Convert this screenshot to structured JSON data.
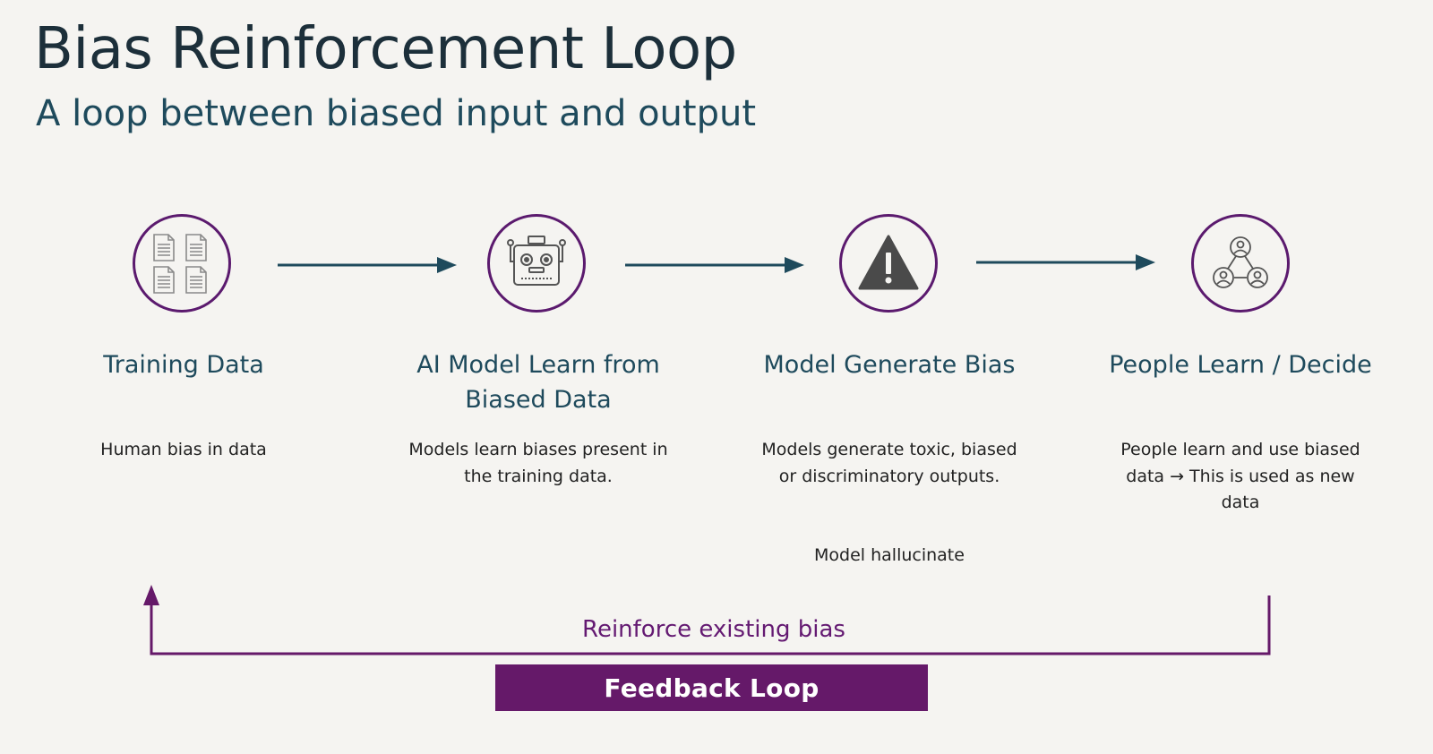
{
  "title": "Bias Reinforcement Loop",
  "subtitle": "A loop between biased input and output",
  "steps": [
    {
      "icon": "documents-icon",
      "title": "Training Data",
      "description": "Human bias in data",
      "note": ""
    },
    {
      "icon": "robot-icon",
      "title": "AI Model Learn from Biased Data",
      "description": "Models learn biases present in the training data.",
      "note": ""
    },
    {
      "icon": "warning-icon",
      "title": "Model Generate Bias",
      "description": "Models generate toxic, biased or discriminatory outputs.",
      "note": "Model hallucinate"
    },
    {
      "icon": "people-network-icon",
      "title": "People Learn / Decide",
      "description": "People learn and use biased data → This is used as new data",
      "note": ""
    }
  ],
  "feedback": {
    "label": "Reinforce existing bias",
    "button_label": "Feedback Loop"
  },
  "colors": {
    "accent": "#651969",
    "arrow": "#1e4a5c",
    "title": "#1c2f3a",
    "background": "#f5f4f1"
  }
}
